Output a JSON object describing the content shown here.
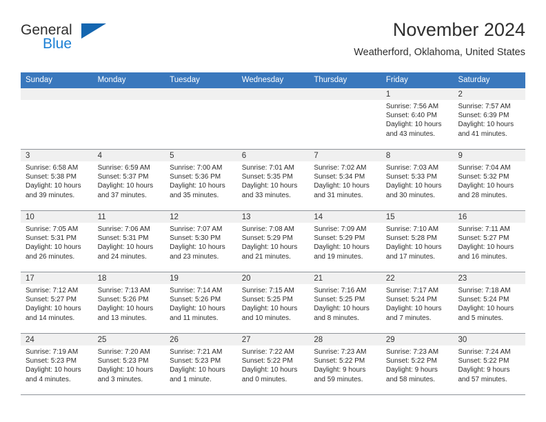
{
  "brand": {
    "line1": "General",
    "line2": "Blue",
    "triangle_color": "#1466b0",
    "line2_color": "#1b7fd4"
  },
  "header": {
    "title": "November 2024",
    "subtitle": "Weatherford, Oklahoma, United States"
  },
  "theme": {
    "header_blue": "#3a78bd",
    "day_strip_gray": "#f0f0f0",
    "row_border": "#8e9399"
  },
  "weekdays": [
    "Sunday",
    "Monday",
    "Tuesday",
    "Wednesday",
    "Thursday",
    "Friday",
    "Saturday"
  ],
  "weeks": [
    [
      {
        "day": "",
        "sunrise": "",
        "sunset": "",
        "daylight": "",
        "empty": true
      },
      {
        "day": "",
        "sunrise": "",
        "sunset": "",
        "daylight": "",
        "empty": true
      },
      {
        "day": "",
        "sunrise": "",
        "sunset": "",
        "daylight": "",
        "empty": true
      },
      {
        "day": "",
        "sunrise": "",
        "sunset": "",
        "daylight": "",
        "empty": true
      },
      {
        "day": "",
        "sunrise": "",
        "sunset": "",
        "daylight": "",
        "empty": true
      },
      {
        "day": "1",
        "sunrise": "Sunrise: 7:56 AM",
        "sunset": "Sunset: 6:40 PM",
        "daylight": "Daylight: 10 hours and 43 minutes."
      },
      {
        "day": "2",
        "sunrise": "Sunrise: 7:57 AM",
        "sunset": "Sunset: 6:39 PM",
        "daylight": "Daylight: 10 hours and 41 minutes."
      }
    ],
    [
      {
        "day": "3",
        "sunrise": "Sunrise: 6:58 AM",
        "sunset": "Sunset: 5:38 PM",
        "daylight": "Daylight: 10 hours and 39 minutes."
      },
      {
        "day": "4",
        "sunrise": "Sunrise: 6:59 AM",
        "sunset": "Sunset: 5:37 PM",
        "daylight": "Daylight: 10 hours and 37 minutes."
      },
      {
        "day": "5",
        "sunrise": "Sunrise: 7:00 AM",
        "sunset": "Sunset: 5:36 PM",
        "daylight": "Daylight: 10 hours and 35 minutes."
      },
      {
        "day": "6",
        "sunrise": "Sunrise: 7:01 AM",
        "sunset": "Sunset: 5:35 PM",
        "daylight": "Daylight: 10 hours and 33 minutes."
      },
      {
        "day": "7",
        "sunrise": "Sunrise: 7:02 AM",
        "sunset": "Sunset: 5:34 PM",
        "daylight": "Daylight: 10 hours and 31 minutes."
      },
      {
        "day": "8",
        "sunrise": "Sunrise: 7:03 AM",
        "sunset": "Sunset: 5:33 PM",
        "daylight": "Daylight: 10 hours and 30 minutes."
      },
      {
        "day": "9",
        "sunrise": "Sunrise: 7:04 AM",
        "sunset": "Sunset: 5:32 PM",
        "daylight": "Daylight: 10 hours and 28 minutes."
      }
    ],
    [
      {
        "day": "10",
        "sunrise": "Sunrise: 7:05 AM",
        "sunset": "Sunset: 5:31 PM",
        "daylight": "Daylight: 10 hours and 26 minutes."
      },
      {
        "day": "11",
        "sunrise": "Sunrise: 7:06 AM",
        "sunset": "Sunset: 5:31 PM",
        "daylight": "Daylight: 10 hours and 24 minutes."
      },
      {
        "day": "12",
        "sunrise": "Sunrise: 7:07 AM",
        "sunset": "Sunset: 5:30 PM",
        "daylight": "Daylight: 10 hours and 23 minutes."
      },
      {
        "day": "13",
        "sunrise": "Sunrise: 7:08 AM",
        "sunset": "Sunset: 5:29 PM",
        "daylight": "Daylight: 10 hours and 21 minutes."
      },
      {
        "day": "14",
        "sunrise": "Sunrise: 7:09 AM",
        "sunset": "Sunset: 5:29 PM",
        "daylight": "Daylight: 10 hours and 19 minutes."
      },
      {
        "day": "15",
        "sunrise": "Sunrise: 7:10 AM",
        "sunset": "Sunset: 5:28 PM",
        "daylight": "Daylight: 10 hours and 17 minutes."
      },
      {
        "day": "16",
        "sunrise": "Sunrise: 7:11 AM",
        "sunset": "Sunset: 5:27 PM",
        "daylight": "Daylight: 10 hours and 16 minutes."
      }
    ],
    [
      {
        "day": "17",
        "sunrise": "Sunrise: 7:12 AM",
        "sunset": "Sunset: 5:27 PM",
        "daylight": "Daylight: 10 hours and 14 minutes."
      },
      {
        "day": "18",
        "sunrise": "Sunrise: 7:13 AM",
        "sunset": "Sunset: 5:26 PM",
        "daylight": "Daylight: 10 hours and 13 minutes."
      },
      {
        "day": "19",
        "sunrise": "Sunrise: 7:14 AM",
        "sunset": "Sunset: 5:26 PM",
        "daylight": "Daylight: 10 hours and 11 minutes."
      },
      {
        "day": "20",
        "sunrise": "Sunrise: 7:15 AM",
        "sunset": "Sunset: 5:25 PM",
        "daylight": "Daylight: 10 hours and 10 minutes."
      },
      {
        "day": "21",
        "sunrise": "Sunrise: 7:16 AM",
        "sunset": "Sunset: 5:25 PM",
        "daylight": "Daylight: 10 hours and 8 minutes."
      },
      {
        "day": "22",
        "sunrise": "Sunrise: 7:17 AM",
        "sunset": "Sunset: 5:24 PM",
        "daylight": "Daylight: 10 hours and 7 minutes."
      },
      {
        "day": "23",
        "sunrise": "Sunrise: 7:18 AM",
        "sunset": "Sunset: 5:24 PM",
        "daylight": "Daylight: 10 hours and 5 minutes."
      }
    ],
    [
      {
        "day": "24",
        "sunrise": "Sunrise: 7:19 AM",
        "sunset": "Sunset: 5:23 PM",
        "daylight": "Daylight: 10 hours and 4 minutes."
      },
      {
        "day": "25",
        "sunrise": "Sunrise: 7:20 AM",
        "sunset": "Sunset: 5:23 PM",
        "daylight": "Daylight: 10 hours and 3 minutes."
      },
      {
        "day": "26",
        "sunrise": "Sunrise: 7:21 AM",
        "sunset": "Sunset: 5:23 PM",
        "daylight": "Daylight: 10 hours and 1 minute."
      },
      {
        "day": "27",
        "sunrise": "Sunrise: 7:22 AM",
        "sunset": "Sunset: 5:22 PM",
        "daylight": "Daylight: 10 hours and 0 minutes."
      },
      {
        "day": "28",
        "sunrise": "Sunrise: 7:23 AM",
        "sunset": "Sunset: 5:22 PM",
        "daylight": "Daylight: 9 hours and 59 minutes."
      },
      {
        "day": "29",
        "sunrise": "Sunrise: 7:23 AM",
        "sunset": "Sunset: 5:22 PM",
        "daylight": "Daylight: 9 hours and 58 minutes."
      },
      {
        "day": "30",
        "sunrise": "Sunrise: 7:24 AM",
        "sunset": "Sunset: 5:22 PM",
        "daylight": "Daylight: 9 hours and 57 minutes."
      }
    ]
  ]
}
